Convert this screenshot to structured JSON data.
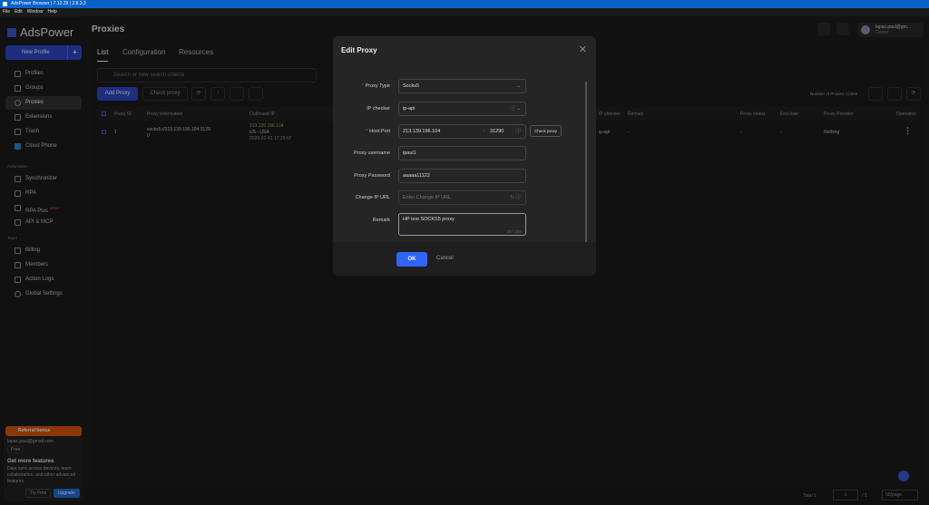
{
  "window": {
    "title": "AdsPower Browser | 7.12.29 | 2.8.3.3",
    "menu": [
      "File",
      "Edit",
      "Window",
      "Help"
    ]
  },
  "sidebar": {
    "brand": "AdsPower",
    "new_profile": "New Profile",
    "items": [
      "Profiles",
      "Groups",
      "Proxies",
      "Extensions",
      "Trash",
      "Cloud Phone"
    ],
    "automation_label": "Automation",
    "automation": [
      "Synchronizer",
      "RPA",
      "RPA Plus",
      "API & MCP"
    ],
    "new_badge": "NEW!",
    "team_label": "Team",
    "team": [
      "Billing",
      "Members",
      "Action Logs",
      "Global Settings"
    ],
    "referral": "Referral bonus",
    "email": "lapas.paul@gmail.com",
    "plan": "Free",
    "promo_title": "Get more features",
    "promo_text": "Data sync across devices, team collaboration, and other advanced features.",
    "try_free": "Try Free",
    "upgrade": "Upgrade"
  },
  "header": {
    "title": "Proxies",
    "user_name": "lapas.paul@gm...",
    "user_role": "Owner"
  },
  "tabs": [
    "List",
    "Configuration",
    "Resources"
  ],
  "search_placeholder": "Search or new search criteria",
  "toolbar": {
    "add_proxy": "Add Proxy",
    "check_proxy": "Check proxy",
    "count_label": "Number of Proxies:",
    "count": "1",
    "count_max": "/2000"
  },
  "table": {
    "columns": [
      "Proxy ID",
      "Proxy Information",
      "Outbound IP",
      "IP checker",
      "Remark",
      "Proxy status",
      "End date",
      "Proxy Provider",
      "Operation"
    ],
    "rows": [
      {
        "id": "1",
        "info": "socks5://213.139.196.104:3129",
        "info2": "0",
        "ip": "213.139.196.104",
        "country": "US - USA",
        "date": "2026-02-01 17:29:07",
        "checker": "ip-api",
        "remark": "-",
        "status": "-",
        "end": "-",
        "provider": "Nothing"
      }
    ]
  },
  "footer": {
    "total": "Total 1",
    "page": "1",
    "pages": "/ 1",
    "per_page": "50/page"
  },
  "modal": {
    "title": "Edit Proxy",
    "fields": {
      "proxy_type_label": "Proxy Type",
      "proxy_type": "Socks5",
      "ip_checker_label": "IP checker",
      "ip_checker": "ip-api",
      "host_label": "Host:Port",
      "host": "213.139.196.104",
      "port": "31290",
      "check_proxy": "Check proxy",
      "username_label": "Proxy username",
      "username": "ipaul1",
      "password_label": "Proxy Password",
      "password": "aaaaa11122",
      "change_ip_label": "Change IP URL",
      "change_ip_placeholder": "Enter Change IP URL",
      "remark_label": "Remark",
      "remark": "HP test SOCKS5 proxy",
      "remark_count": "20 / 200"
    },
    "ok": "OK",
    "cancel": "Cancel"
  },
  "colors": {
    "accent": "#3064f2",
    "titlebar": "#0b63c9",
    "referral": "#e2590c",
    "ip_green": "#8bc34a"
  }
}
